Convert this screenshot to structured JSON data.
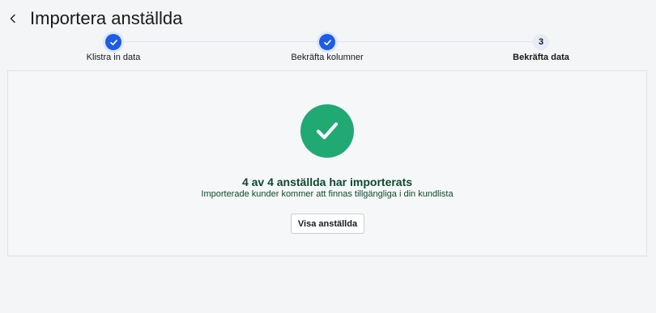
{
  "header": {
    "back_icon": "chevron-left-icon",
    "title": "Importera anställda"
  },
  "stepper": {
    "steps": [
      {
        "label": "Klistra in data",
        "status": "completed",
        "icon": "check-icon"
      },
      {
        "label": "Bekräfta kolumner",
        "status": "completed",
        "icon": "check-icon"
      },
      {
        "label": "Bekräfta data",
        "status": "current",
        "number": "3"
      }
    ]
  },
  "result": {
    "icon": "check-icon",
    "title": "4 av 4 anställda har importerats",
    "subtitle": "Importerade kunder kommer att finnas tillgängliga i din kundlista",
    "button_label": "Visa anställda"
  },
  "colors": {
    "primary": "#1d5ce6",
    "success": "#20a973",
    "success_text": "#0c4a2c",
    "background": "#f4f5f7"
  }
}
